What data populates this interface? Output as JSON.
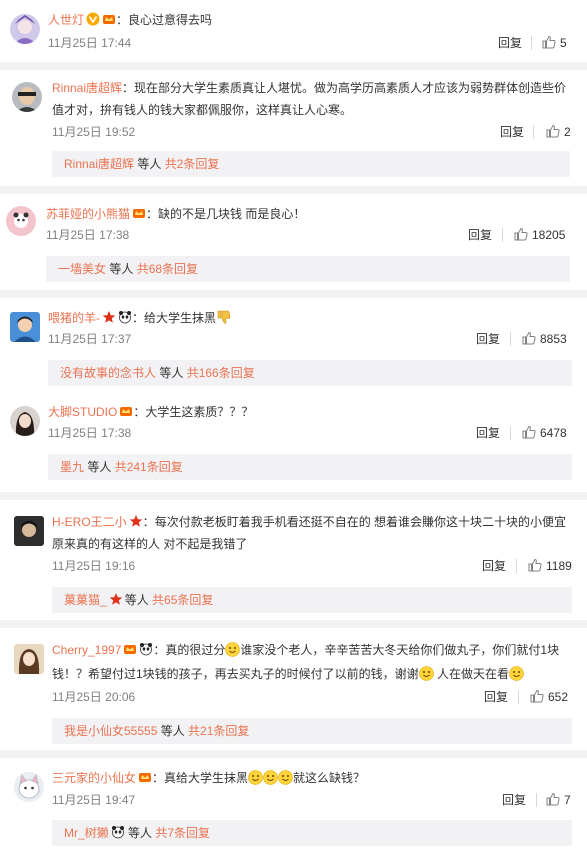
{
  "comments": [
    {
      "user": "人世灯",
      "text": "良心过意得去吗",
      "date": "11月25日 17:44",
      "reply": "回复",
      "likes": "5"
    },
    {
      "user": "Rinnai唐超辉",
      "text_line1": "现在部分大学生素质真让人堪忧。做为高学历高素质人才应该为弱势群体创造些价",
      "text_line2": "值才对，拚有钱人的钱大家都佩服你，这样真让人心寒。",
      "date": "11月25日 19:52",
      "reply": "回复",
      "likes": "2",
      "sub_user": "Rinnai唐超辉",
      "sub_mid": " 等人 ",
      "sub_count": "共2条回复"
    },
    {
      "user": "苏菲娅的小熊猫",
      "text": "缺的不是几块钱 而是良心！",
      "date": "11月25日 17:38",
      "reply": "回复",
      "likes": "18205",
      "sub_user": "一墙美女",
      "sub_mid": " 等人 ",
      "sub_count": "共68条回复"
    },
    {
      "user": "喂猪的羊-",
      "text": "给大学生抹黑",
      "date": "11月25日 17:37",
      "reply": "回复",
      "likes": "8853",
      "sub_user": "没有故事的念书人",
      "sub_mid": " 等人 ",
      "sub_count": "共166条回复"
    },
    {
      "user": "大脚STUDIO",
      "text": "大学生这素质？？？",
      "date": "11月25日 17:38",
      "reply": "回复",
      "likes": "6478",
      "sub_user": "墨九",
      "sub_mid": " 等人 ",
      "sub_count": "共241条回复"
    },
    {
      "user": "H-ERO王二小",
      "text_line1": "每次付款老板盯着我手机看还挺不自在的 想着谁会賺你这十块二十块的小便宜",
      "text_line2": "原来真的有这样的人 对不起是我错了",
      "date": "11月25日 19:16",
      "reply": "回复",
      "likes": "1189",
      "sub_user": "菓菓猫_",
      "sub_mid": "等人 ",
      "sub_count": "共65条回复"
    },
    {
      "user": "Cherry_1997",
      "text_a": "真的很过分",
      "text_b": "谁家没个老人，辛辛苦苦大冬天给你们做丸子，你们就付1块",
      "text_line2a": "钱！？希望付过1块钱的孩子，再去买丸子的时候付了以前的钱，谢谢",
      "text_line2b": " 人在做天在看",
      "date": "11月25日 20:06",
      "reply": "回复",
      "likes": "652",
      "sub_user": "我是小仙女55555",
      "sub_mid": " 等人 ",
      "sub_count": "共21条回复"
    },
    {
      "user": "三元家的小仙女",
      "text_a": "真给大学生抹黑",
      "text_b": "就这么缺钱？",
      "date": "11月25日 19:47",
      "reply": "回复",
      "likes": "7",
      "sub_user": "Mr_树獭",
      "sub_mid": " 等人 ",
      "sub_count": "共7条回复"
    }
  ],
  "colors": {
    "username": "#eb7350",
    "separator": "#f2f2f5"
  }
}
